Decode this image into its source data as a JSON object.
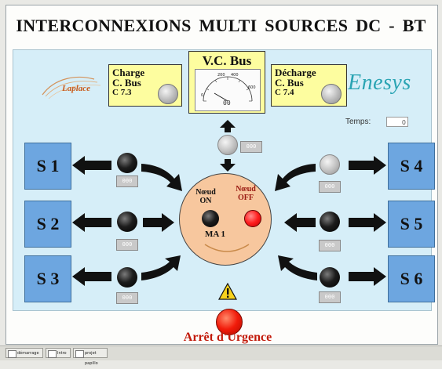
{
  "title": "INTERCONNEXIONS  MULTI SOURCES  DC - BT",
  "charge_box": {
    "line1": "Charge",
    "line2": "C. Bus",
    "line3": "C 7.3"
  },
  "decharge_box": {
    "line1": "Décharge",
    "line2": "C. Bus",
    "line3": "C 7.4"
  },
  "vc_bus": {
    "label": "V.C. Bus",
    "ticks": [
      "200",
      "400",
      "0",
      "600"
    ],
    "readout": "00"
  },
  "logos": {
    "left": "Laplace",
    "right": "Enesys"
  },
  "temps": {
    "label": "Temps:",
    "value": "0"
  },
  "sources": [
    "S 1",
    "S 2",
    "S 3",
    "S 4",
    "S 5",
    "S 6"
  ],
  "value_readout": "000",
  "node": {
    "on_label_1": "Nœud",
    "on_label_2": "ON",
    "off_label_1": "Nœud",
    "off_label_2": "OFF",
    "name": "MA 1"
  },
  "emergency": {
    "label": "Arrêt d'Urgence"
  },
  "taskbar": [
    "démarrage",
    "Intro",
    "projet papillo"
  ],
  "colors": {
    "panel": "#d6eef8",
    "source": "#6da6e0",
    "yellow": "#fdfd9f",
    "node": "#f7c79e",
    "emergency": "#c21a0a"
  }
}
